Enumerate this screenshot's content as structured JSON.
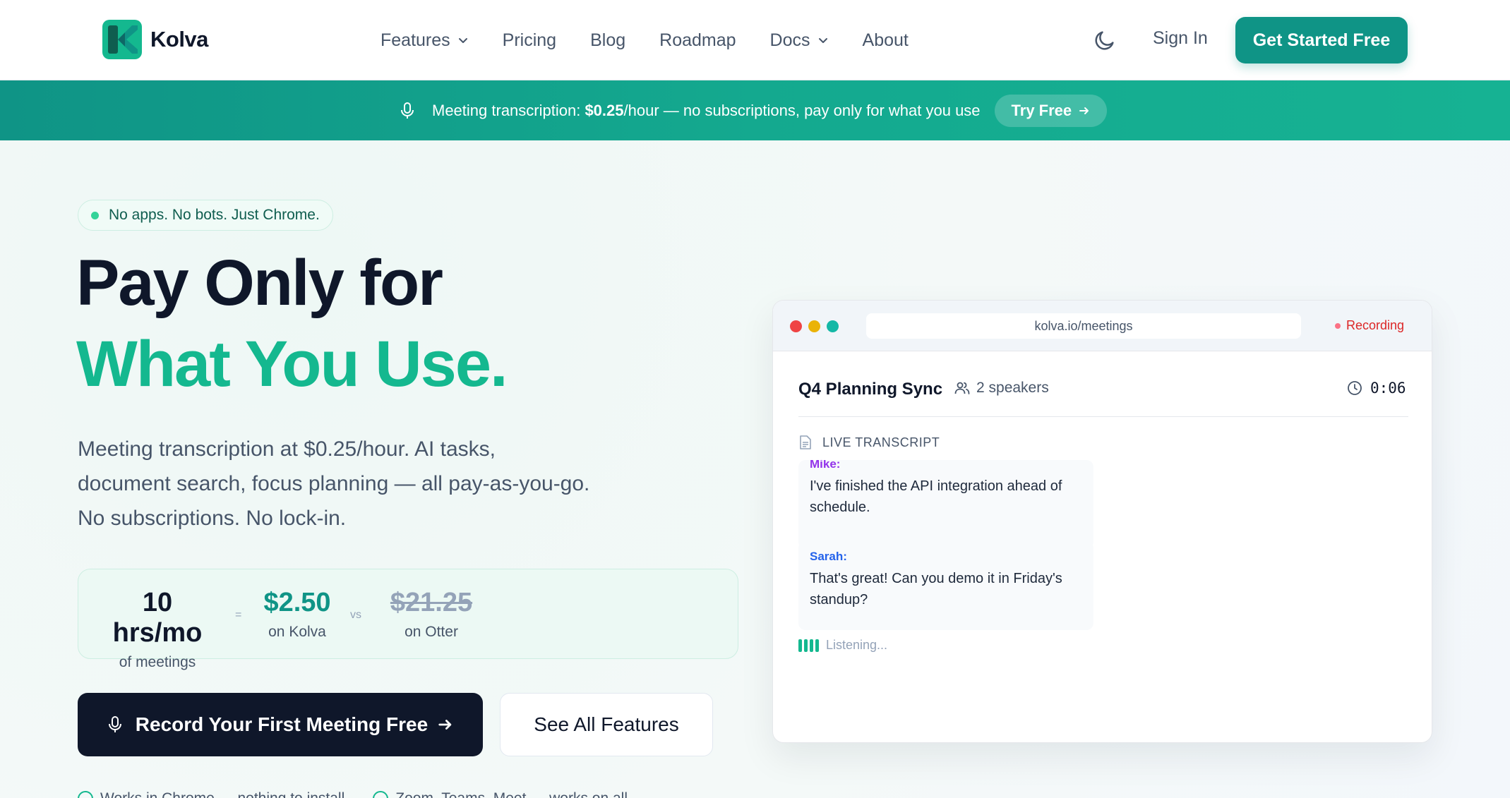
{
  "brand": {
    "name": "Kolva"
  },
  "nav": {
    "links": [
      {
        "label": "Features",
        "dropdown": true
      },
      {
        "label": "Pricing",
        "dropdown": false
      },
      {
        "label": "Blog",
        "dropdown": false
      },
      {
        "label": "Roadmap",
        "dropdown": false
      },
      {
        "label": "Docs",
        "dropdown": true
      },
      {
        "label": "About",
        "dropdown": false
      }
    ],
    "theme_icon": "moon-icon",
    "signin_label": "Sign In",
    "cta_label": "Get Started Free"
  },
  "banner": {
    "lead": "Meeting transcription: ",
    "price": "$0.25",
    "rest": "/hour — no subscriptions, pay only for what you use",
    "button_label": "Try Free"
  },
  "hero": {
    "pill": "No apps. No bots. Just Chrome.",
    "headline_1": "Pay Only for",
    "headline_2": "What You Use.",
    "subtext_1": "Meeting transcription at $0.25/hour. AI tasks,",
    "subtext_2": "document search, focus planning — all pay-as-you-go.",
    "subtext_3": "No subscriptions. No lock-in.",
    "compare": {
      "usage_big": "10 hrs/mo",
      "usage_small": "of meetings",
      "equals": "=",
      "kolva_big": "$2.50",
      "kolva_small": "on Kolva",
      "vs": "vs",
      "otter_big": "$21.25",
      "otter_small": "on Otter"
    },
    "primary_button": "Record Your First Meeting Free",
    "secondary_button": "See All Features",
    "trust_1": "Works in Chrome — nothing to install",
    "trust_2": "Zoom, Teams, Meet — works on all"
  },
  "mock": {
    "url": "kolva.io/meetings",
    "recording_label": "Recording",
    "meeting_title": "Q4 Planning Sync",
    "speakers": "2 speakers",
    "timer": "0:06",
    "live_label": "LIVE TRANSCRIPT",
    "messages": [
      {
        "speaker": "Mike:",
        "text_1": "I've finished the API integration ahead of",
        "text_2": "schedule.",
        "color": "#9333ea"
      },
      {
        "speaker": "Sarah:",
        "text_1": "That's great! Can you demo it in Friday's",
        "text_2": "standup?",
        "color": "#2563eb"
      }
    ],
    "listening": "Listening..."
  },
  "colors": {
    "accent": "#0f9486",
    "accent_light": "#14b88f",
    "dark": "#0f172a",
    "recording": "#dc2626"
  }
}
